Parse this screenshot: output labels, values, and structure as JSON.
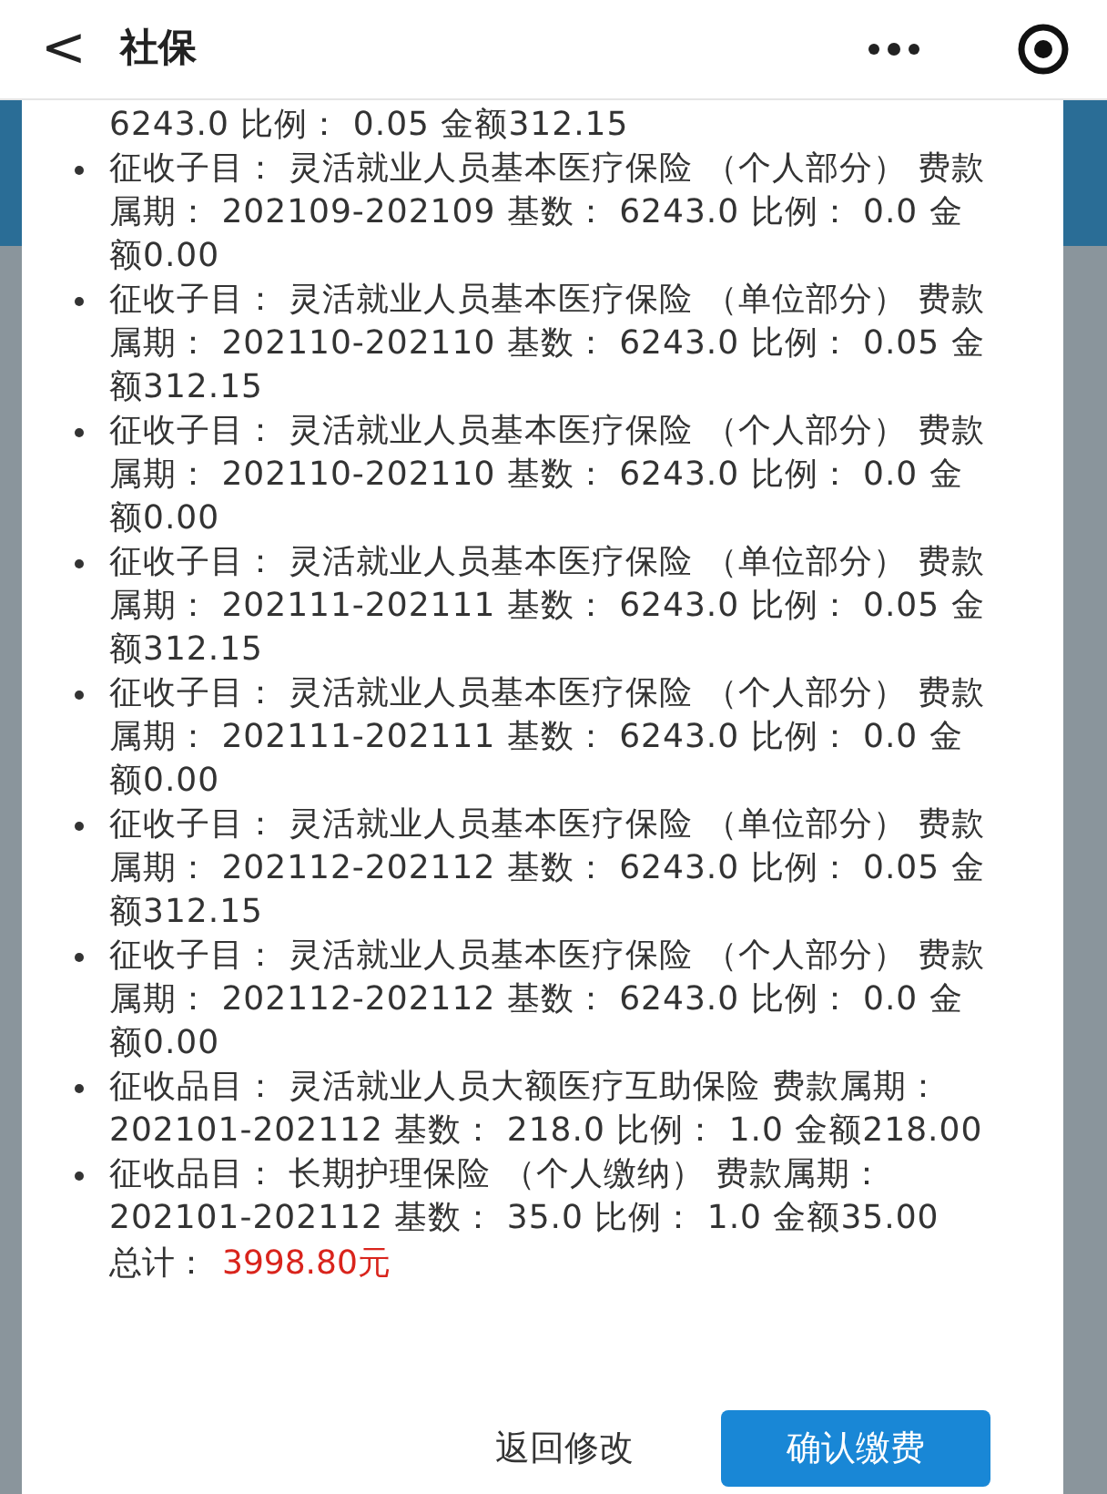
{
  "header": {
    "back": "<",
    "title": "社保"
  },
  "items": [
    {
      "bulleted": false,
      "text": "6243.0 比例： 0.05 金额312.15"
    },
    {
      "bulleted": true,
      "text": "征收子目： 灵活就业人员基本医疗保险 （个人部分） 费款属期： 202109-202109 基数： 6243.0 比例： 0.0 金额0.00"
    },
    {
      "bulleted": true,
      "text": "征收子目： 灵活就业人员基本医疗保险 （单位部分） 费款属期： 202110-202110 基数： 6243.0 比例： 0.05 金额312.15"
    },
    {
      "bulleted": true,
      "text": "征收子目： 灵活就业人员基本医疗保险 （个人部分） 费款属期： 202110-202110 基数： 6243.0 比例： 0.0 金额0.00"
    },
    {
      "bulleted": true,
      "text": "征收子目： 灵活就业人员基本医疗保险 （单位部分） 费款属期： 202111-202111 基数： 6243.0 比例： 0.05 金额312.15"
    },
    {
      "bulleted": true,
      "text": "征收子目： 灵活就业人员基本医疗保险 （个人部分） 费款属期： 202111-202111 基数： 6243.0 比例： 0.0 金额0.00"
    },
    {
      "bulleted": true,
      "text": "征收子目： 灵活就业人员基本医疗保险 （单位部分） 费款属期： 202112-202112 基数： 6243.0 比例： 0.05 金额312.15"
    },
    {
      "bulleted": true,
      "text": "征收子目： 灵活就业人员基本医疗保险 （个人部分） 费款属期： 202112-202112 基数： 6243.0 比例： 0.0 金额0.00"
    },
    {
      "bulleted": true,
      "text": "征收品目： 灵活就业人员大额医疗互助保险 费款属期： 202101-202112 基数： 218.0 比例： 1.0 金额218.00"
    },
    {
      "bulleted": true,
      "text": "征收品目： 长期护理保险 （个人缴纳） 费款属期： 202101-202112 基数： 35.0 比例： 1.0 金额35.00"
    }
  ],
  "total": {
    "label": "总计：",
    "amount": "3998.80元"
  },
  "buttons": {
    "back": "返回修改",
    "confirm": "确认缴费"
  }
}
